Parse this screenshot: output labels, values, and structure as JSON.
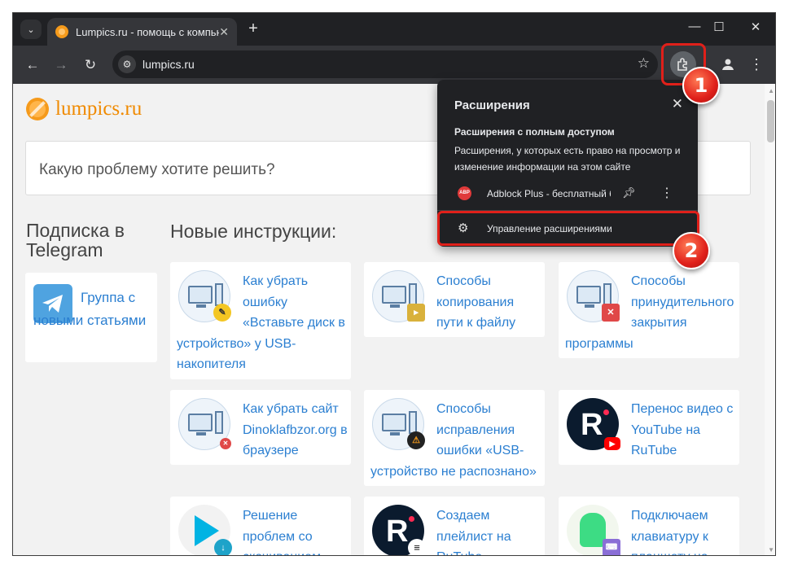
{
  "browser": {
    "tab_title": "Lumpics.ru - помощь с компьютером",
    "tab_close": "✕",
    "new_tab": "+",
    "url": "lumpics.ru",
    "window_controls": [
      "—",
      "☐",
      "✕"
    ]
  },
  "page": {
    "logo_text": "lumpics.ru",
    "search_placeholder": "Какую проблему хотите решить?",
    "left_heading": "Подписка в Telegram",
    "right_heading": "Новые инструкции:",
    "telegram_card": "Группа с новыми статьями",
    "articles": [
      {
        "title": "Как убрать ошибку «Вставьте диск в устройство» у USB-накопителя",
        "icon": "pc-edit-icon"
      },
      {
        "title": "Способы копирования пути к файлу",
        "icon": "pc-folder-icon"
      },
      {
        "title": "Способы принудительного закрытия программы",
        "icon": "pc-close-icon"
      },
      {
        "title": "Как убрать сайт Dinoklafbzor.org в браузере",
        "icon": "pc-block-icon"
      },
      {
        "title": "Способы исправления ошибки «USB-устройство не распознано»",
        "icon": "pc-warning-icon"
      },
      {
        "title": "Перенос видео с YouTube на RuTube",
        "icon": "rutube-youtube-icon"
      },
      {
        "title": "Решение проблем со скачиванием",
        "icon": "google-play-icon"
      },
      {
        "title": "Создаем плейлист на RuTube",
        "icon": "rutube-playlist-icon"
      },
      {
        "title": "Подключаем клавиатуру к планшету на",
        "icon": "android-icon"
      }
    ]
  },
  "extensions_popup": {
    "title": "Расширения",
    "full_access_heading": "Расширения с полным доступом",
    "full_access_desc": "Расширения, у которых есть право на просмотр и изменение информации на этом сайте",
    "extension_badge": "ABP",
    "extension_name": "Adblock Plus - бесплатный блокировщик рекламы",
    "manage_label": "Управление расширениями"
  },
  "steps": [
    "1",
    "2"
  ],
  "colors": {
    "accent_red": "#e0201a",
    "link_blue": "#2b7fd1",
    "brand_orange": "#f08a00",
    "popup_bg": "#202124"
  }
}
